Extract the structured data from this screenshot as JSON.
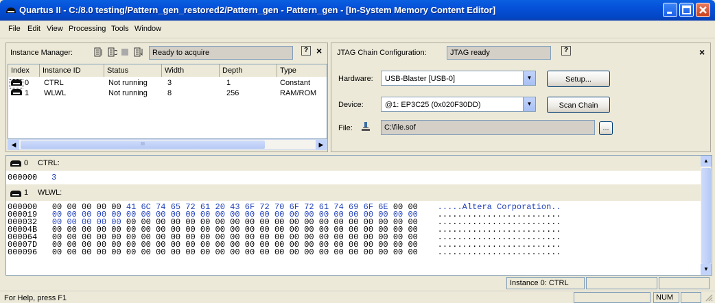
{
  "window": {
    "title": "Quartus II - C:/8.0 testing/Pattern_gen_restored2/Pattern_gen - Pattern_gen - [In-System Memory Content Editor]"
  },
  "menu": [
    "File",
    "Edit",
    "View",
    "Processing",
    "Tools",
    "Window"
  ],
  "instance_manager": {
    "label": "Instance Manager:",
    "status": "Ready to acquire",
    "help": "?",
    "close": "×",
    "columns": [
      "Index",
      "Instance ID",
      "Status",
      "Width",
      "Depth",
      "Type"
    ],
    "rows": [
      {
        "index": "0",
        "id": "CTRL",
        "status": "Not running",
        "width": "3",
        "depth": "1",
        "type": "Constant"
      },
      {
        "index": "1",
        "id": "WLWL",
        "status": "Not running",
        "width": "8",
        "depth": "256",
        "type": "RAM/ROM"
      }
    ],
    "scroll_thumb": "III"
  },
  "jtag": {
    "label": "JTAG Chain Configuration:",
    "status": "JTAG ready",
    "help": "?",
    "close": "×",
    "hardware_label": "Hardware:",
    "hardware_value": "USB-Blaster [USB-0]",
    "setup_button": "Setup...",
    "device_label": "Device:",
    "device_value": "@1: EP3C25 (0x020F30DD)",
    "scan_button": "Scan Chain",
    "file_label": "File:",
    "file_value": "C:\\file.sof",
    "browse_button": "..."
  },
  "memory": {
    "ctrl": {
      "index": "0",
      "label": "CTRL:",
      "address": "000000",
      "value": "3"
    },
    "wlwl": {
      "index": "1",
      "label": "WLWL:"
    },
    "hex_rows": [
      {
        "addr": "000000",
        "bytes": [
          "00",
          "00",
          "00",
          "00",
          "00",
          "41",
          "6C",
          "74",
          "65",
          "72",
          "61",
          "20",
          "43",
          "6F",
          "72",
          "70",
          "6F",
          "72",
          "61",
          "74",
          "69",
          "6F",
          "6E",
          "00",
          "00"
        ],
        "ascii": ".....Altera Corporation.."
      },
      {
        "addr": "000019",
        "bytes": [
          "00",
          "00",
          "00",
          "00",
          "00",
          "00",
          "00",
          "00",
          "00",
          "00",
          "00",
          "00",
          "00",
          "00",
          "00",
          "00",
          "00",
          "00",
          "00",
          "00",
          "00",
          "00",
          "00",
          "00",
          "00"
        ],
        "ascii": "........................."
      },
      {
        "addr": "000032",
        "bytes": [
          "00",
          "00",
          "00",
          "00",
          "00",
          "00",
          "00",
          "00",
          "00",
          "00",
          "00",
          "00",
          "00",
          "00",
          "00",
          "00",
          "00",
          "00",
          "00",
          "00",
          "00",
          "00",
          "00",
          "00",
          "00"
        ],
        "ascii": "........................."
      },
      {
        "addr": "00004B",
        "bytes": [
          "00",
          "00",
          "00",
          "00",
          "00",
          "00",
          "00",
          "00",
          "00",
          "00",
          "00",
          "00",
          "00",
          "00",
          "00",
          "00",
          "00",
          "00",
          "00",
          "00",
          "00",
          "00",
          "00",
          "00",
          "00"
        ],
        "ascii": "........................."
      },
      {
        "addr": "000064",
        "bytes": [
          "00",
          "00",
          "00",
          "00",
          "00",
          "00",
          "00",
          "00",
          "00",
          "00",
          "00",
          "00",
          "00",
          "00",
          "00",
          "00",
          "00",
          "00",
          "00",
          "00",
          "00",
          "00",
          "00",
          "00",
          "00"
        ],
        "ascii": "........................."
      },
      {
        "addr": "00007D",
        "bytes": [
          "00",
          "00",
          "00",
          "00",
          "00",
          "00",
          "00",
          "00",
          "00",
          "00",
          "00",
          "00",
          "00",
          "00",
          "00",
          "00",
          "00",
          "00",
          "00",
          "00",
          "00",
          "00",
          "00",
          "00",
          "00"
        ],
        "ascii": "........................."
      },
      {
        "addr": "000096",
        "bytes": [
          "00",
          "00",
          "00",
          "00",
          "00",
          "00",
          "00",
          "00",
          "00",
          "00",
          "00",
          "00",
          "00",
          "00",
          "00",
          "00",
          "00",
          "00",
          "00",
          "00",
          "00",
          "00",
          "00",
          "00",
          "00"
        ],
        "ascii": "........................."
      }
    ],
    "blue_byte_rows": {
      "000000": [
        5,
        6,
        7,
        8,
        9,
        10,
        11,
        12,
        13,
        14,
        15,
        16,
        17,
        18,
        19,
        20,
        21,
        22
      ],
      "000019": [
        0,
        1,
        2,
        3,
        4,
        5,
        6,
        7,
        8,
        9,
        10,
        11,
        12,
        13,
        14,
        15,
        16,
        17,
        18,
        19,
        20,
        21,
        22,
        23,
        24
      ],
      "000032": [
        0,
        1,
        2,
        3,
        4
      ]
    },
    "status_field": "Instance 0: CTRL"
  },
  "statusbar": {
    "help": "For Help, press F1",
    "num": "NUM"
  }
}
